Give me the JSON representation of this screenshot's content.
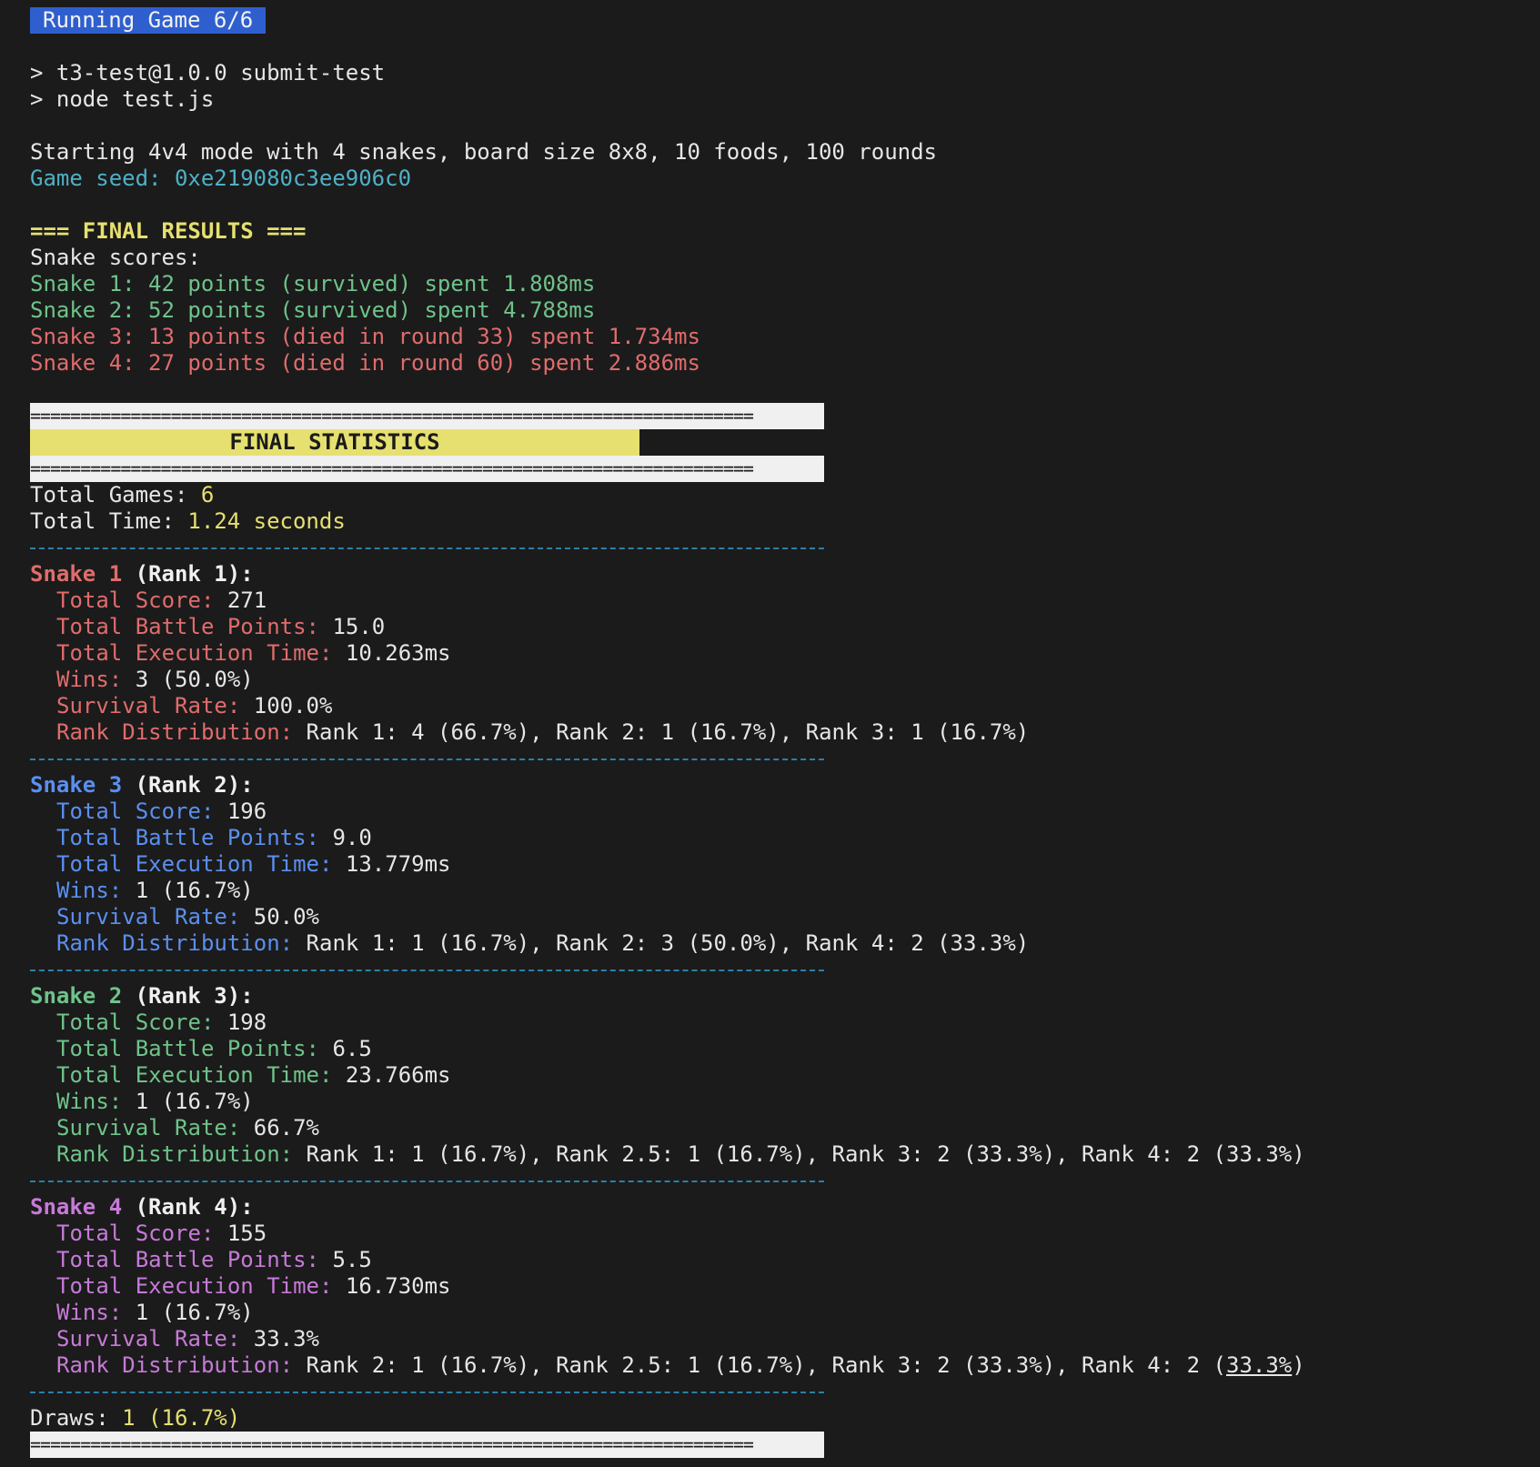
{
  "badge": "Running Game 6/6",
  "cmd1": "> t3-test@1.0.0 submit-test",
  "cmd2": "> node test.js",
  "starting": "Starting 4v4 mode with 4 snakes, board size 8x8, 10 foods, 100 rounds",
  "seed": "Game seed: 0xe219080c3ee906c0",
  "final_results": "=== FINAL RESULTS ===",
  "scores_label": "Snake scores:",
  "scores": [
    "Snake 1: 42 points (survived) spent 1.808ms",
    "Snake 2: 52 points (survived) spent 4.788ms",
    "Snake 3: 13 points (died in round 33) spent 1.734ms",
    "Snake 4: 27 points (died in round 60) spent 2.886ms"
  ],
  "rule_line": "========================================================================",
  "stats_title": "FINAL STATISTICS",
  "total_games_label": "Total Games: ",
  "total_games": "6",
  "total_time_label": "Total Time: ",
  "total_time": "1.24 seconds",
  "labels": {
    "score": "Total Score: ",
    "battle": "Total Battle Points: ",
    "exec": "Total Execution Time: ",
    "wins": "Wins: ",
    "survival": "Survival Rate: ",
    "dist": "Rank Distribution: "
  },
  "snakes": [
    {
      "name": "Snake 1",
      "rank": " (Rank 1):",
      "score": "271",
      "battle": "15.0",
      "exec": "10.263ms",
      "wins": "3 (50.0%)",
      "survival": "100.0%",
      "dist": "Rank 1: 4 (66.7%), Rank 2: 1 (16.7%), Rank 3: 1 (16.7%)"
    },
    {
      "name": "Snake 3",
      "rank": " (Rank 2):",
      "score": "196",
      "battle": "9.0",
      "exec": "13.779ms",
      "wins": "1 (16.7%)",
      "survival": "50.0%",
      "dist": "Rank 1: 1 (16.7%), Rank 2: 3 (50.0%), Rank 4: 2 (33.3%)"
    },
    {
      "name": "Snake 2",
      "rank": " (Rank 3):",
      "score": "198",
      "battle": "6.5",
      "exec": "23.766ms",
      "wins": "1 (16.7%)",
      "survival": "66.7%",
      "dist": "Rank 1: 1 (16.7%), Rank 2.5: 1 (16.7%), Rank 3: 2 (33.3%), Rank 4: 2 (33.3%)"
    },
    {
      "name": "Snake 4",
      "rank": " (Rank 4):",
      "score": "155",
      "battle": "5.5",
      "exec": "16.730ms",
      "wins": "1 (16.7%)",
      "survival": "33.3%",
      "dist_pre": "Rank 2: 1 (16.7%), Rank 2.5: 1 (16.7%), Rank 3: 2 (33.3%), Rank 4: 2 (",
      "dist_u": "33.3%",
      "dist_post": ")"
    }
  ],
  "draws_label": "Draws: ",
  "draws": "1 (16.7%)",
  "colors": {
    "background": "#1b1b1b",
    "badge": "#2f5fcf",
    "cyan": "#4fb0c6",
    "green": "#6fc38a",
    "red": "#e06c6c",
    "blue": "#5b8ff0",
    "magenta": "#c77ad8",
    "yellow": "#e6e070"
  }
}
